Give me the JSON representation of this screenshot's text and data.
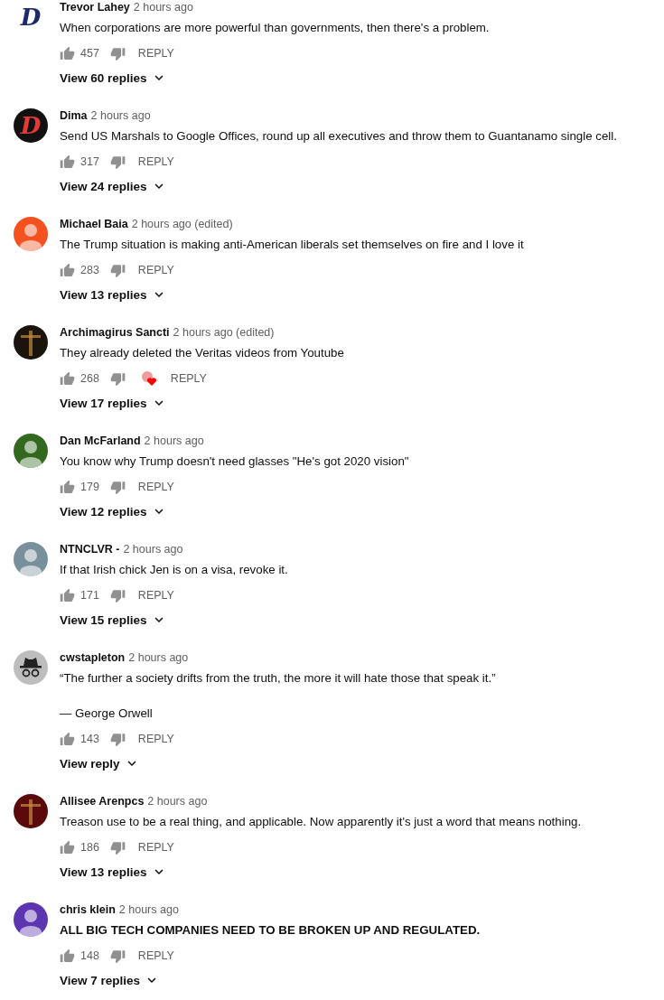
{
  "comments": [
    {
      "author": "Trevor Lahey",
      "time": "2 hours ago",
      "avatar": {
        "kind": "crest",
        "letter": "D",
        "color": "#ffffff"
      },
      "body": [
        "When corporations are more powerful than governments, then there's a problem."
      ],
      "bold": false,
      "likes": "457",
      "hearted": false,
      "reply": "REPLY",
      "view": "View 60 replies"
    },
    {
      "author": "Dima",
      "time": "2 hours ago",
      "avatar": {
        "kind": "badge",
        "letter": "D",
        "color": "#111111"
      },
      "body": [
        "Send US Marshals to Google Offices, round up all executives and throw them to Guantanamo single cell."
      ],
      "bold": false,
      "likes": "317",
      "hearted": false,
      "reply": "REPLY",
      "view": "View 24 replies"
    },
    {
      "author": "Michael Baia",
      "time": "2 hours ago (edited)",
      "avatar": {
        "kind": "person",
        "color": "#f4511e"
      },
      "body": [
        "The Trump situation is making anti-American liberals set themselves on fire and I love it"
      ],
      "bold": false,
      "likes": "283",
      "hearted": false,
      "reply": "REPLY",
      "view": "View 13 replies"
    },
    {
      "author": "Archimagirus Sancti",
      "time": "2 hours ago (edited)",
      "avatar": {
        "kind": "photo",
        "color": "#1a140c"
      },
      "body": [
        "They already deleted the Veritas videos from Youtube"
      ],
      "bold": false,
      "likes": "268",
      "hearted": true,
      "reply": "REPLY",
      "view": "View 17 replies"
    },
    {
      "author": "Dan McFarland",
      "time": "2 hours ago",
      "avatar": {
        "kind": "person",
        "color": "#33691e"
      },
      "body": [
        "You know why Trump doesn't need glasses \"He's got 2020 vision\""
      ],
      "bold": false,
      "likes": "179",
      "hearted": false,
      "reply": "REPLY",
      "view": "View 12 replies"
    },
    {
      "author": "NTNCLVR -",
      "time": "2 hours ago",
      "avatar": {
        "kind": "person",
        "color": "#78909c"
      },
      "body": [
        "If that Irish chick Jen is on a visa, revoke it."
      ],
      "bold": false,
      "likes": "171",
      "hearted": false,
      "reply": "REPLY",
      "view": "View 15 replies"
    },
    {
      "author": "cwstapleton",
      "time": "2 hours ago",
      "avatar": {
        "kind": "incognito",
        "color": "#bdbdbd"
      },
      "body": [
        "“The further a society drifts from the truth, the more it will hate those that speak it.”",
        "— George Orwell"
      ],
      "bold": false,
      "likes": "143",
      "hearted": false,
      "reply": "REPLY",
      "view": "View reply"
    },
    {
      "author": "Allisee Arenpcs",
      "time": "2 hours ago",
      "avatar": {
        "kind": "photo",
        "color": "#5a0a0a"
      },
      "body": [
        "Treason use to be a real thing, and applicable. Now apparently it's just a word that means nothing."
      ],
      "bold": false,
      "likes": "186",
      "hearted": false,
      "reply": "REPLY",
      "view": "View 13 replies"
    },
    {
      "author": "chris klein",
      "time": "2 hours ago",
      "avatar": {
        "kind": "person",
        "color": "#5e35b1"
      },
      "body": [
        "ALL BIG TECH COMPANIES NEED TO BE BROKEN UP AND REGULATED."
      ],
      "bold": true,
      "likes": "148",
      "hearted": false,
      "reply": "REPLY",
      "view": "View 7 replies"
    }
  ]
}
